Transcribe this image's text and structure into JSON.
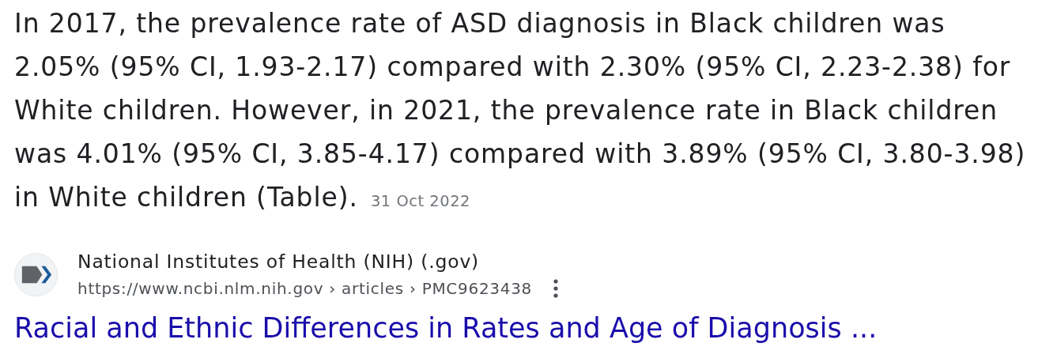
{
  "snippet": {
    "lines": [
      "In 2017, the prevalence rate of ASD diagnosis in Black children was",
      "2.05% (95% CI, 1.93-2.17) compared with 2.30% (95% CI, 2.23-2.38) for",
      "White children. However, in 2021, the prevalence rate in Black children",
      "was 4.01% (95% CI, 3.85-4.17) compared with 3.89% (95% CI, 3.80-3.98)",
      "in White children (Table)."
    ],
    "date": "31 Oct 2022"
  },
  "source": {
    "site_name": "National Institutes of Health (NIH) (.gov)",
    "url": "https://www.ncbi.nlm.nih.gov › articles › PMC9623438"
  },
  "result_title": "Racial and Ethnic Differences in Rates and Age of Diagnosis ..."
}
